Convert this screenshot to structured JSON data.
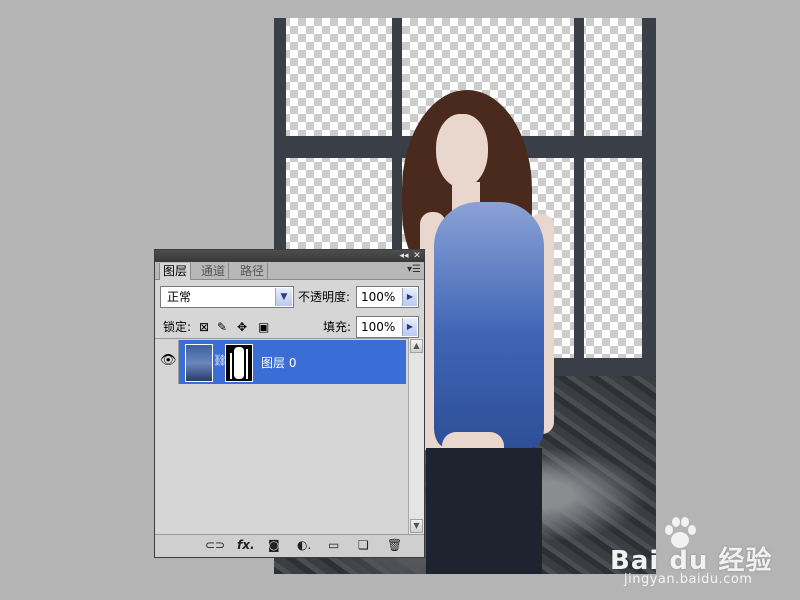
{
  "panel": {
    "tabs": [
      {
        "label": "图层"
      },
      {
        "label": "通道"
      },
      {
        "label": "路径"
      }
    ],
    "blend_mode": {
      "value": "正常"
    },
    "opacity": {
      "label": "不透明度:",
      "value": "100%"
    },
    "lock": {
      "label": "锁定:"
    },
    "fill": {
      "label": "填充:",
      "value": "100%"
    },
    "layers": [
      {
        "name": "图层 0",
        "visible": true,
        "selected": true,
        "has_mask": true
      }
    ],
    "footer_icons": [
      "link-icon",
      "fx-icon",
      "mask-icon",
      "adjustment-icon",
      "folder-icon",
      "new-layer-icon",
      "trash-icon"
    ]
  },
  "watermark": {
    "brand": "Bai du 经验",
    "url": "jingyan.baidu.com"
  },
  "colors": {
    "selection": "#3a6ed6",
    "panel_bg": "#d6d6d6",
    "workspace": "#b4b4b4"
  }
}
